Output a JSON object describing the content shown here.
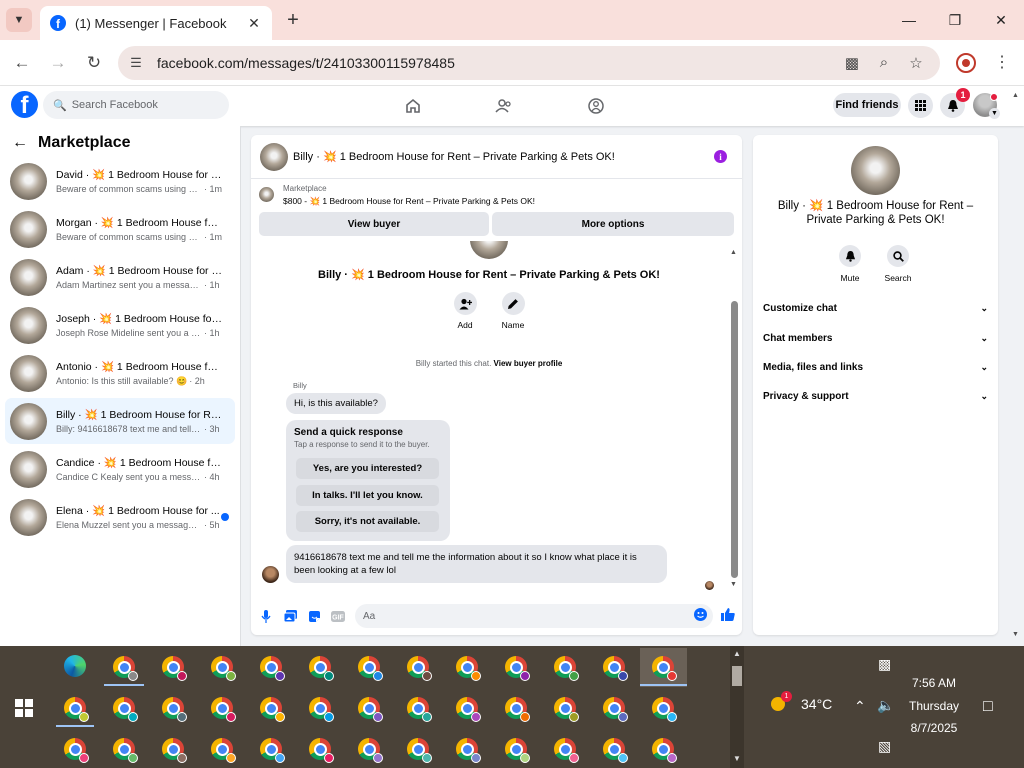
{
  "browser": {
    "tab_title": "(1) Messenger | Facebook",
    "url": "facebook.com/messages/t/24103300115978485"
  },
  "fb_header": {
    "search_placeholder": "Search Facebook",
    "find_friends": "Find friends",
    "notification_count": "1"
  },
  "sidebar": {
    "title": "Marketplace",
    "conversations": [
      {
        "name": "David · 💥 1 Bedroom House for R...",
        "snippet": "Beware of common scams using pay...",
        "time": "· 1m"
      },
      {
        "name": "Morgan · 💥 1 Bedroom House for...",
        "snippet": "Beware of common scams using pay...",
        "time": "· 1m"
      },
      {
        "name": "Adam · 💥 1 Bedroom House for R...",
        "snippet": "Adam Martinez sent you a message a...",
        "time": "· 1h"
      },
      {
        "name": "Joseph · 💥 1 Bedroom House for ...",
        "snippet": "Joseph Rose Mideline sent you a mess...",
        "time": "· 1h"
      },
      {
        "name": "Antonio · 💥 1 Bedroom House for...",
        "snippet": "Antonio: Is this still available? 😊",
        "time": "· 2h"
      },
      {
        "name": "Billy · 💥 1 Bedroom House for Re...",
        "snippet": "Billy: 9416618678 text me and tell me ...",
        "time": "· 3h"
      },
      {
        "name": "Candice · 💥 1 Bedroom House for...",
        "snippet": "Candice C Kealy sent you a message a...",
        "time": "· 4h"
      },
      {
        "name": "Elena · 💥 1 Bedroom House for ...",
        "snippet": "Elena Muzzel sent you a message a...",
        "time": "· 5h"
      }
    ]
  },
  "chat": {
    "header_title": "Billy · 💥 1 Bedroom House for Rent – Private Parking & Pets OK!",
    "marketplace_label": "Marketplace",
    "listing": "$800 - 💥 1 Bedroom House for Rent – Private Parking & Pets OK!",
    "view_buyer": "View buyer",
    "more_options": "More options",
    "center_title": "Billy · 💥 1 Bedroom House for Rent – Private Parking & Pets OK!",
    "add_label": "Add",
    "name_label": "Name",
    "started_text": "Billy started this chat.",
    "view_buyer_profile": "View buyer profile",
    "sender": "Billy",
    "message1": "Hi, is this available?",
    "quick_title": "Send a quick response",
    "quick_sub": "Tap a response to send it to the buyer.",
    "quick_options": [
      "Yes, are you interested?",
      "In talks. I'll let you know.",
      "Sorry, it's not available."
    ],
    "message2": "9416618678 text me and tell me the information about it so I know what place it is been looking at a few lol",
    "composer_placeholder": "Aa"
  },
  "info_panel": {
    "title": "Billy · 💥 1 Bedroom House for Rent – Private Parking & Pets OK!",
    "mute": "Mute",
    "search": "Search",
    "rows": [
      "Customize chat",
      "Chat members",
      "Media, files and links",
      "Privacy & support"
    ]
  },
  "taskbar": {
    "temperature": "34°C",
    "weather_badge": "1",
    "time": "7:56 AM",
    "day": "Thursday",
    "date": "8/7/2025"
  },
  "colors": {
    "fb_blue": "#0866ff",
    "active_conv": "#ebf5ff",
    "tab_bar": "#f9e0dc",
    "info_icon": "#9b1fe0",
    "taskbar": "#4a4238"
  }
}
